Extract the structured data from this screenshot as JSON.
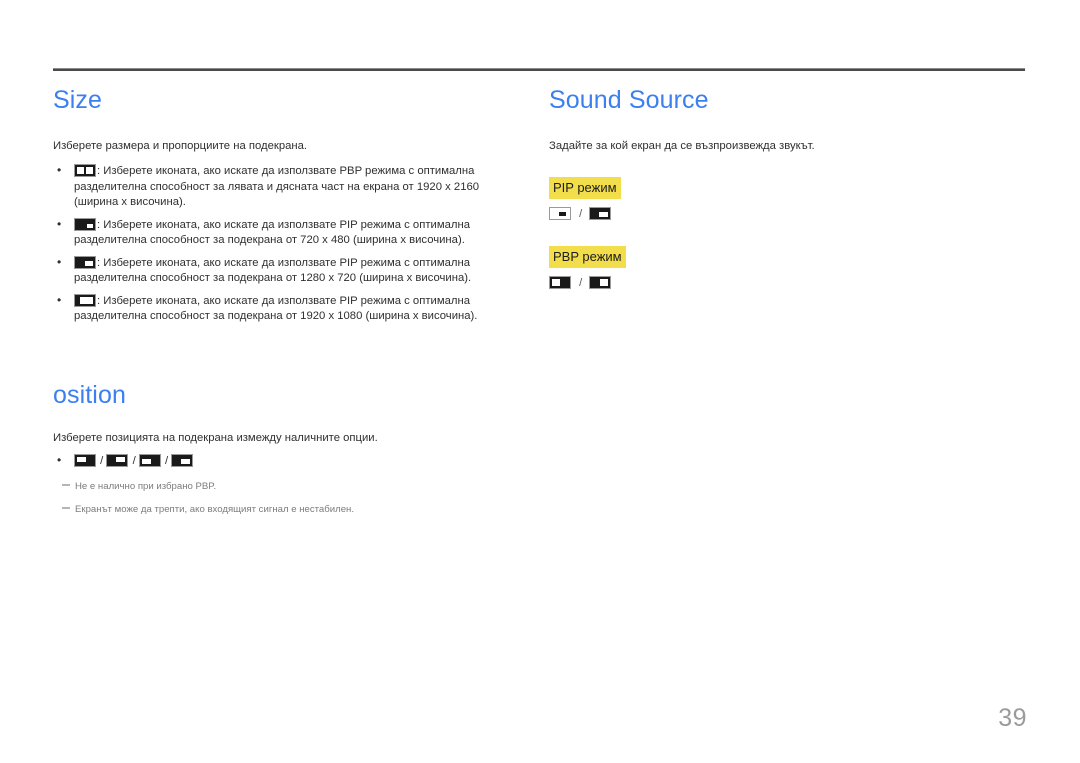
{
  "page": {
    "number": "39",
    "accent_color": "#3b7ff0",
    "highlight_color": "#f2dd4b",
    "note_color": "#7c7c7c"
  },
  "left_column": {
    "size_section": {
      "title": "Size",
      "intro": "Изберете размера и пропорциите на подекрана.",
      "bullets": [
        {
          "icon": "pbp-split-screen-icon",
          "text": ": Изберете иконата, ако искате да използвате PBP режима с оптимална разделителна способност за лявата и дясната част на екрана от 1920 x 2160 (ширина х височина)."
        },
        {
          "icon": "pip-small-screen-icon",
          "text": ": Изберете иконата, ако искате да използвате PIP режима с оптимална разделителна способност за подекрана от 720 x 480 (ширина х височина)."
        },
        {
          "icon": "pip-medium-screen-icon",
          "text": ": Изберете иконата, ако искате да използвате PIP режима с оптимална разделителна способност за подекрана от 1280 x 720 (ширина х височина)."
        },
        {
          "icon": "pip-large-screen-icon",
          "text": ": Изберете иконата, ако искате да използвате PIP режима с оптимална разделителна способност за подекрана от 1920 x 1080 (ширина х височина)."
        }
      ]
    },
    "position_section": {
      "title": "osition",
      "intro": "Изберете позицията на подекрана измежду наличните опции.",
      "icons": [
        "position-top-left-icon",
        "position-top-right-icon",
        "position-bottom-left-icon",
        "position-bottom-right-icon"
      ],
      "separator": "/",
      "notes": [
        "Не е налично при избрано PBP.",
        "Екранът може да трепти, ако входящият сигнал е нестабилен."
      ]
    }
  },
  "right_column": {
    "sound_source_section": {
      "title": "Sound Source",
      "intro": "Задайте за кой екран да се възпроизвежда звукът.",
      "groups": [
        {
          "badge": "PIP режим",
          "separator": "/",
          "icons": [
            "sound-main-screen-icon",
            "sound-sub-screen-icon"
          ]
        },
        {
          "badge": "PBP режим",
          "separator": "/",
          "icons": [
            "sound-left-screen-icon",
            "sound-right-screen-icon"
          ]
        }
      ]
    }
  }
}
